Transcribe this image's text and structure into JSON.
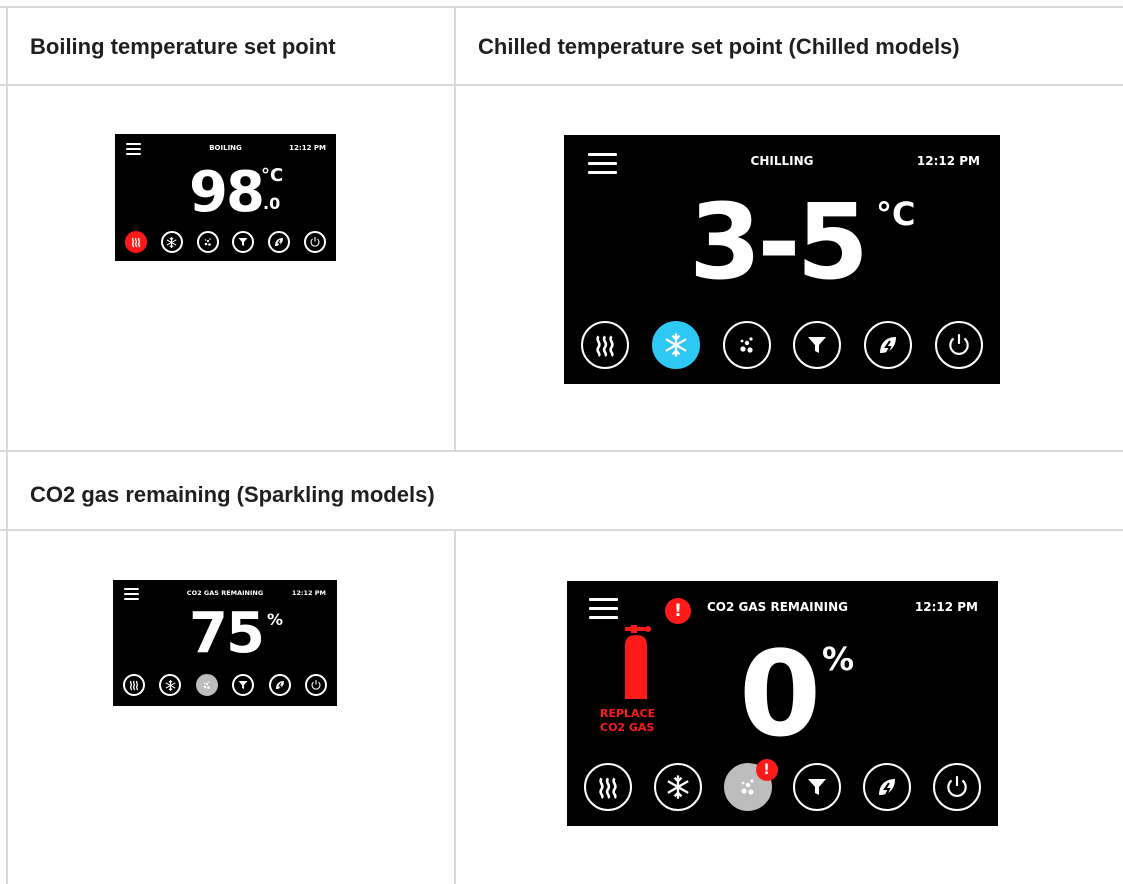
{
  "table": {
    "headers": {
      "boiling": "Boiling temperature set point",
      "chilled": "Chilled temperature set point (Chilled models)",
      "co2": "CO2 gas remaining (Sparkling models)"
    }
  },
  "screens": {
    "boiling": {
      "title": "BOILING",
      "time": "12:12 PM",
      "value": "98",
      "unit": "°C",
      "decimal": ".0"
    },
    "chilling": {
      "title": "CHILLING",
      "time": "12:12 PM",
      "value": "3-5",
      "unit": "°C"
    },
    "co2_small": {
      "title": "CO2 GAS REMAINING",
      "time": "12:12 PM",
      "value": "75",
      "unit": "%"
    },
    "co2_large": {
      "title": "CO2 GAS REMAINING",
      "time": "12:12 PM",
      "value": "0",
      "unit": "%",
      "alert_glyph": "!",
      "replace_line1": "REPLACE",
      "replace_line2": "CO2 GAS"
    }
  },
  "icons": [
    "boiling-icon",
    "chilled-icon",
    "sparkling-icon",
    "filter-icon",
    "eco-icon",
    "power-icon"
  ],
  "colors": {
    "boiling_active": "#ff1a1a",
    "chilled_active": "#2ec8f5",
    "sparkling_active": "#bdbdbd",
    "alert": "#ff1a1a"
  }
}
